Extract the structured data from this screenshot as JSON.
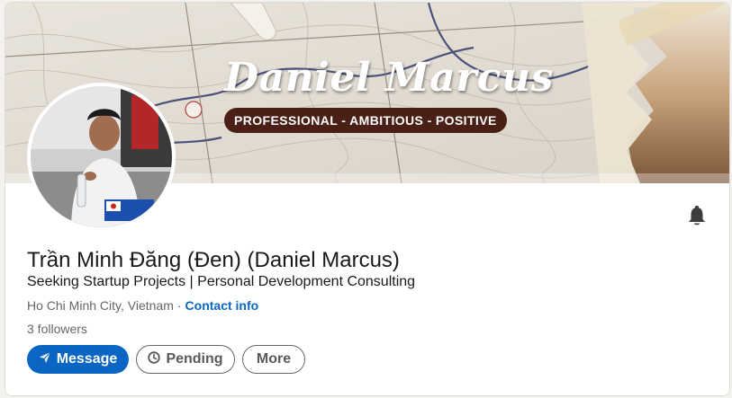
{
  "banner": {
    "title": "Daniel Marcus",
    "tagline": "PROFESSIONAL - AMBITIOUS - POSITIVE"
  },
  "profile": {
    "name": "Trần Minh Đăng (Đen) (Daniel Marcus)",
    "headline": "Seeking Startup Projects | Personal Development Consulting",
    "location": "Ho Chi Minh City, Vietnam",
    "separator": "·",
    "contact_label": "Contact info",
    "followers": "3 followers"
  },
  "actions": {
    "message_label": "Message",
    "pending_label": "Pending",
    "more_label": "More"
  },
  "icons": {
    "message": "send-icon",
    "pending": "clock-icon",
    "notify": "bell-icon"
  },
  "colors": {
    "primary": "#0a66c2",
    "text": "#191919",
    "muted": "#666666",
    "banner_tag_bg": "#4a2016"
  }
}
